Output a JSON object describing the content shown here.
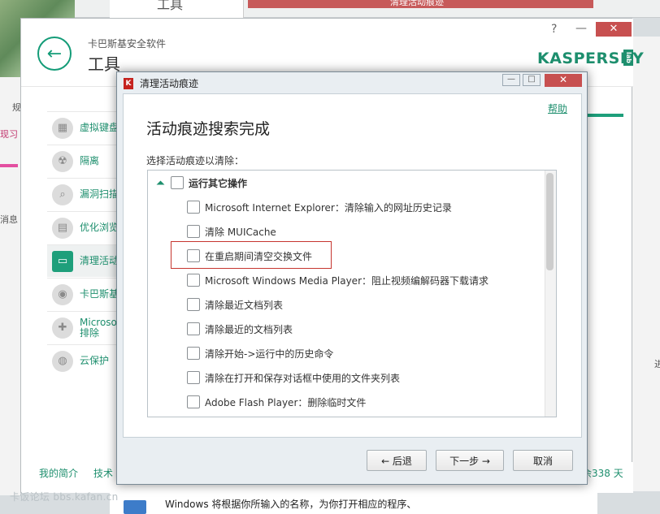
{
  "background": {
    "top_card_text": "工具",
    "top_bar_text": "清理活动痕迹",
    "left_text_1": "规",
    "left_text_2": "现习",
    "left_text_3": "消息",
    "right_text": "进",
    "taskbar_text": "Windows 将根据你所输入的名称，为你打开相应的程序、",
    "watermark": "卡饭论坛 bbs.kafan.cn"
  },
  "app": {
    "product_name": "卡巴斯基安全软件",
    "page_title": "工具",
    "help_label": "?",
    "minimize_label": "—",
    "close_label": "✕",
    "logo_text": "KASPERSKY",
    "logo_lab": "lab",
    "back_arrow": "←"
  },
  "sidebar": {
    "items": [
      {
        "label": "虚拟键盘",
        "icon": "▦"
      },
      {
        "label": "隔离",
        "icon": "☢"
      },
      {
        "label": "漏洞扫描",
        "icon": "⌕"
      },
      {
        "label": "优化浏览",
        "icon": "▤"
      },
      {
        "label": "清理活动",
        "icon": "▭"
      },
      {
        "label": "卡巴斯基",
        "icon": "◉"
      },
      {
        "label": "Microsof 排除",
        "icon": "✚"
      },
      {
        "label": "云保护",
        "icon": "◍"
      }
    ]
  },
  "footer": {
    "my_profile": "我的简介",
    "tech": "技术",
    "license": "余338 天"
  },
  "dialog": {
    "title": "清理活动痕迹",
    "title_icon": "K",
    "min_label": "—",
    "max_label": "□",
    "close_label": "✕",
    "help": "帮助",
    "heading": "活动痕迹搜索完成",
    "subheading": "选择活动痕迹以清除：",
    "group_label": "运行其它操作",
    "items": [
      "Microsoft Internet Explorer：清除输入的网址历史记录",
      "清除 MUICache",
      "在重启期间清空交换文件",
      "Microsoft Windows Media Player：阻止视频编解码器下载请求",
      "清除最近文档列表",
      "清除最近的文档列表",
      "清除开始->运行中的历史命令",
      "清除在打开和保存对话框中使用的文件夹列表",
      "Adobe Flash Player：删除临时文件"
    ],
    "back_button": "← 后退",
    "next_button": "下一步 →",
    "cancel_button": "取消"
  },
  "colors": {
    "accent": "#1e8f6e",
    "close": "#c75050",
    "highlight": "#c6362f"
  }
}
